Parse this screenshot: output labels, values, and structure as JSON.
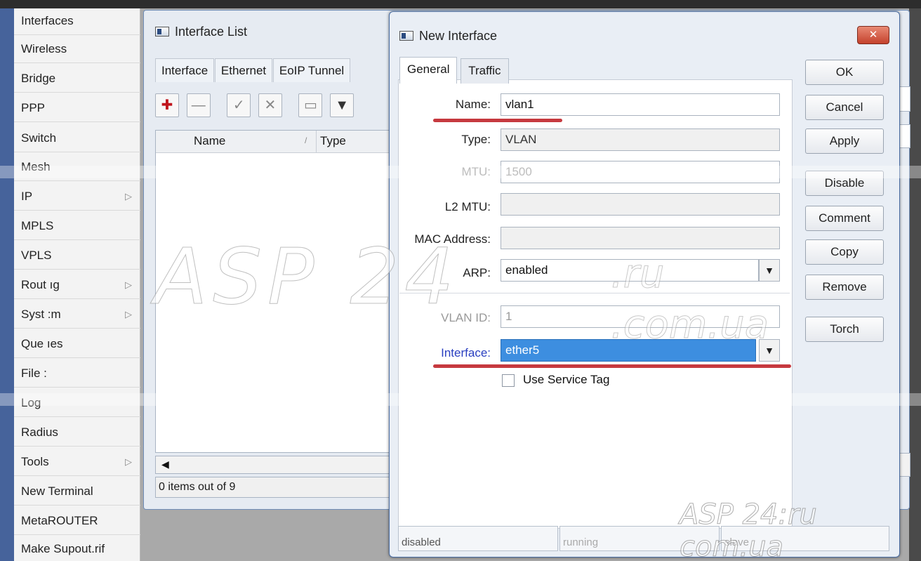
{
  "sidebar": {
    "items": [
      {
        "label": "Interfaces",
        "has_submenu": false
      },
      {
        "label": "Wireless",
        "has_submenu": false
      },
      {
        "label": "Bridge",
        "has_submenu": false
      },
      {
        "label": "PPP",
        "has_submenu": false
      },
      {
        "label": "Switch",
        "has_submenu": false
      },
      {
        "label": "Mesh",
        "has_submenu": false
      },
      {
        "label": "IP",
        "has_submenu": true
      },
      {
        "label": "MPLS",
        "has_submenu": false
      },
      {
        "label": "VPLS",
        "has_submenu": false
      },
      {
        "label": "Rout ıg",
        "has_submenu": true
      },
      {
        "label": "Syst :m",
        "has_submenu": true
      },
      {
        "label": "Que ıes",
        "has_submenu": false
      },
      {
        "label": "File :",
        "has_submenu": false
      },
      {
        "label": "Log",
        "has_submenu": false
      },
      {
        "label": "Radius",
        "has_submenu": false
      },
      {
        "label": "Tools",
        "has_submenu": true
      },
      {
        "label": "New Terminal",
        "has_submenu": false
      },
      {
        "label": "MetaROUTER",
        "has_submenu": false
      },
      {
        "label": "Make Supout.rif",
        "has_submenu": false
      }
    ],
    "submenu_arrow": "▷"
  },
  "interface_list": {
    "title": "Interface List",
    "tabs": [
      "Interface",
      "Ethernet",
      "EoIP Tunnel"
    ],
    "toolbar": {
      "add": "✚",
      "remove": "—",
      "enable": "✓",
      "disable": "✕",
      "comment": "▭",
      "filter": "▼"
    },
    "columns": {
      "name": "Name",
      "sort": "/",
      "type": "Type"
    },
    "scroll_left": "◀",
    "status": "0 items out of 9"
  },
  "new_interface": {
    "title": "New Interface",
    "close": "✕",
    "tabs": {
      "general": "General",
      "traffic": "Traffic"
    },
    "fields": {
      "name": {
        "label": "Name:",
        "value": "vlan1"
      },
      "type": {
        "label": "Type:",
        "value": "VLAN"
      },
      "mtu": {
        "label": "MTU:",
        "value": "1500"
      },
      "l2mtu": {
        "label": "L2 MTU:",
        "value": ""
      },
      "mac": {
        "label": "MAC Address:",
        "value": ""
      },
      "arp": {
        "label": "ARP:",
        "value": "enabled"
      },
      "vlan_id": {
        "label": "VLAN ID:",
        "value": "1"
      },
      "interface": {
        "label": "Interface:",
        "value": "ether5"
      },
      "use_service_tag": {
        "label": "Use Service Tag",
        "checked": false
      }
    },
    "combo_arrow": "▼",
    "buttons": {
      "ok": "OK",
      "cancel": "Cancel",
      "apply": "Apply",
      "disable": "Disable",
      "comment": "Comment",
      "copy": "Copy",
      "remove": "Remove",
      "torch": "Torch"
    },
    "status": {
      "disabled": "disabled",
      "running": "running",
      "slave": "slave"
    }
  },
  "watermark": {
    "big": "ASP 24",
    "ru": ".ru",
    "comua": ".com.ua",
    "small": "ASP 24:ru com.ua"
  },
  "colors": {
    "sidebar_stripe": "#46639b",
    "selected_field": "#3d8ee0",
    "red_underline": "#c6393f",
    "close_button": "#c4412c",
    "interface_label": "#2a3fc0"
  }
}
